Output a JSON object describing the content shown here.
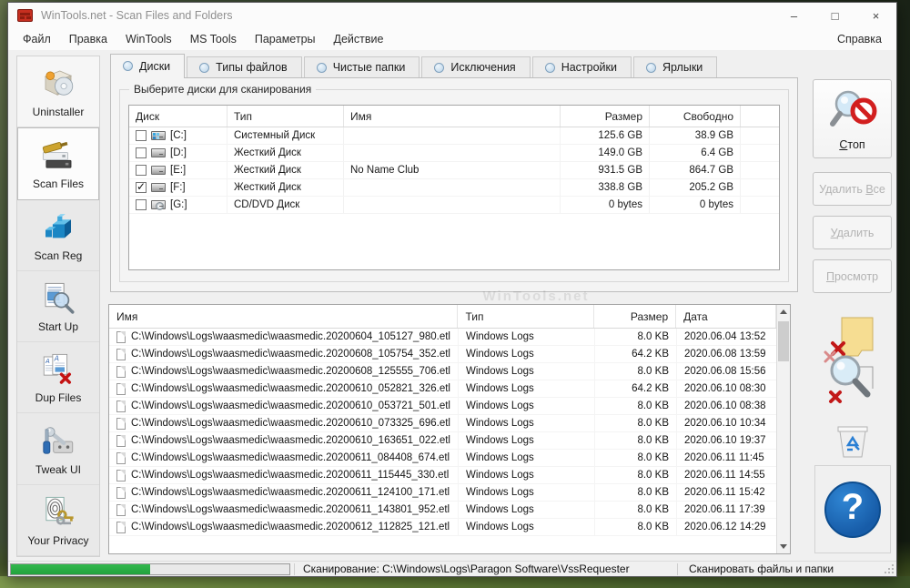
{
  "window": {
    "title": "WinTools.net - Scan Files and Folders",
    "minimize": "–",
    "maximize": "□",
    "close": "×"
  },
  "menu": {
    "items": [
      "Файл",
      "Правка",
      "WinTools",
      "MS Tools",
      "Параметры",
      "Действие"
    ],
    "help": "Справка"
  },
  "sidebar": {
    "items": [
      {
        "label": "Uninstaller",
        "active": false
      },
      {
        "label": "Scan Files",
        "active": true
      },
      {
        "label": "Scan Reg",
        "active": false
      },
      {
        "label": "Start Up",
        "active": false
      },
      {
        "label": "Dup Files",
        "active": false
      },
      {
        "label": "Tweak UI",
        "active": false
      },
      {
        "label": "Your Privacy",
        "active": false
      }
    ]
  },
  "tabs": [
    {
      "label": "Диски",
      "active": true
    },
    {
      "label": "Типы файлов",
      "active": false
    },
    {
      "label": "Чистые папки",
      "active": false
    },
    {
      "label": "Исключения",
      "active": false
    },
    {
      "label": "Настройки",
      "active": false
    },
    {
      "label": "Ярлыки",
      "active": false
    }
  ],
  "scan_group": {
    "title": "Выберите диски для сканирования"
  },
  "disk_table": {
    "columns": [
      "Диск",
      "Тип",
      "Имя",
      "Размер",
      "Свободно"
    ],
    "rows": [
      {
        "checked": false,
        "icon": "system-drive",
        "letter": "[C:]",
        "type": "Системный Диск",
        "name": "",
        "size": "125.6 GB",
        "free": "38.9 GB"
      },
      {
        "checked": false,
        "icon": "hard-drive",
        "letter": "[D:]",
        "type": "Жесткий Диск",
        "name": "",
        "size": "149.0 GB",
        "free": "6.4 GB"
      },
      {
        "checked": false,
        "icon": "hard-drive",
        "letter": "[E:]",
        "type": "Жесткий Диск",
        "name": "No Name Club",
        "size": "931.5 GB",
        "free": "864.7 GB"
      },
      {
        "checked": true,
        "icon": "hard-drive",
        "letter": "[F:]",
        "type": "Жесткий Диск",
        "name": "",
        "size": "338.8 GB",
        "free": "205.2 GB"
      },
      {
        "checked": false,
        "icon": "cd-drive",
        "letter": "[G:]",
        "type": "CD/DVD Диск",
        "name": "",
        "size": "0 bytes",
        "free": "0 bytes"
      }
    ]
  },
  "file_table": {
    "columns": [
      "Имя",
      "Тип",
      "Размер",
      "Дата"
    ],
    "watermark": "WinTools.net",
    "rows": [
      {
        "name": "C:\\Windows\\Logs\\waasmedic\\waasmedic.20200604_105127_980.etl",
        "type": "Windows Logs",
        "size": "8.0 KB",
        "date": "2020.06.04 13:52"
      },
      {
        "name": "C:\\Windows\\Logs\\waasmedic\\waasmedic.20200608_105754_352.etl",
        "type": "Windows Logs",
        "size": "64.2 KB",
        "date": "2020.06.08 13:59"
      },
      {
        "name": "C:\\Windows\\Logs\\waasmedic\\waasmedic.20200608_125555_706.etl",
        "type": "Windows Logs",
        "size": "8.0 KB",
        "date": "2020.06.08 15:56"
      },
      {
        "name": "C:\\Windows\\Logs\\waasmedic\\waasmedic.20200610_052821_326.etl",
        "type": "Windows Logs",
        "size": "64.2 KB",
        "date": "2020.06.10 08:30"
      },
      {
        "name": "C:\\Windows\\Logs\\waasmedic\\waasmedic.20200610_053721_501.etl",
        "type": "Windows Logs",
        "size": "8.0 KB",
        "date": "2020.06.10 08:38"
      },
      {
        "name": "C:\\Windows\\Logs\\waasmedic\\waasmedic.20200610_073325_696.etl",
        "type": "Windows Logs",
        "size": "8.0 KB",
        "date": "2020.06.10 10:34"
      },
      {
        "name": "C:\\Windows\\Logs\\waasmedic\\waasmedic.20200610_163651_022.etl",
        "type": "Windows Logs",
        "size": "8.0 KB",
        "date": "2020.06.10 19:37"
      },
      {
        "name": "C:\\Windows\\Logs\\waasmedic\\waasmedic.20200611_084408_674.etl",
        "type": "Windows Logs",
        "size": "8.0 KB",
        "date": "2020.06.11 11:45"
      },
      {
        "name": "C:\\Windows\\Logs\\waasmedic\\waasmedic.20200611_115445_330.etl",
        "type": "Windows Logs",
        "size": "8.0 KB",
        "date": "2020.06.11 14:55"
      },
      {
        "name": "C:\\Windows\\Logs\\waasmedic\\waasmedic.20200611_124100_171.etl",
        "type": "Windows Logs",
        "size": "8.0 KB",
        "date": "2020.06.11 15:42"
      },
      {
        "name": "C:\\Windows\\Logs\\waasmedic\\waasmedic.20200611_143801_952.etl",
        "type": "Windows Logs",
        "size": "8.0 KB",
        "date": "2020.06.11 17:39"
      },
      {
        "name": "C:\\Windows\\Logs\\waasmedic\\waasmedic.20200612_112825_121.etl",
        "type": "Windows Logs",
        "size": "8.0 KB",
        "date": "2020.06.12 14:29"
      }
    ]
  },
  "actions": {
    "buttons": [
      {
        "label": "Стоп",
        "u": 0,
        "enabled": true
      },
      {
        "label": "Удалить Все",
        "u": 8,
        "enabled": false
      },
      {
        "label": "Удалить",
        "u": 0,
        "enabled": false
      },
      {
        "label": "Просмотр",
        "u": 0,
        "enabled": false
      }
    ]
  },
  "statusbar": {
    "progress_percent": 50,
    "scanning": "Сканирование: C:\\Windows\\Logs\\Paragon Software\\VssRequester",
    "mode": "Сканировать файлы и папки"
  }
}
